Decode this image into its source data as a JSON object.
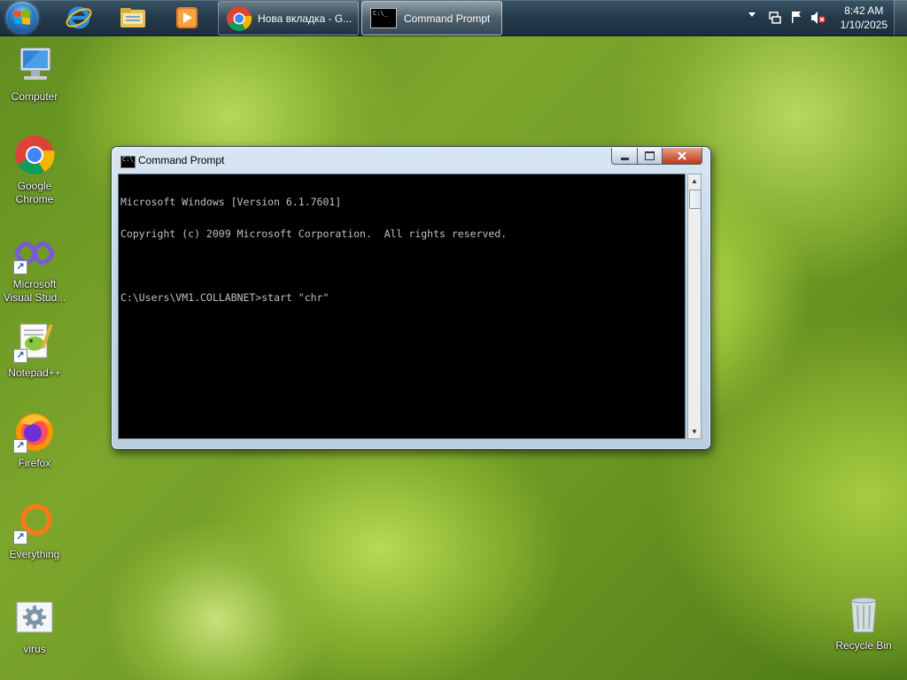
{
  "taskbar": {
    "tasks": [
      {
        "label": "Нова вкладка - G...",
        "icon": "chrome-icon",
        "active": false
      },
      {
        "label": "Command Prompt",
        "icon": "cmd-icon",
        "active": true
      }
    ],
    "pinned": [
      "internet-explorer-icon",
      "windows-explorer-icon",
      "media-player-icon"
    ],
    "clock": {
      "time": "8:42 AM",
      "date": "1/10/2025"
    }
  },
  "desktop": {
    "icons": [
      {
        "label": "Computer",
        "icon": "computer-icon"
      },
      {
        "label": "Google\nChrome",
        "icon": "chrome-icon"
      },
      {
        "label": "Microsoft\nVisual Stud...",
        "icon": "visual-studio-icon"
      },
      {
        "label": "Notepad++",
        "icon": "notepad-plus-plus-icon"
      },
      {
        "label": "Firefox",
        "icon": "firefox-icon"
      },
      {
        "label": "Everything",
        "icon": "everything-search-icon"
      },
      {
        "label": "virus",
        "icon": "settings-file-icon"
      },
      {
        "label": "Recycle Bin",
        "icon": "recycle-bin-icon"
      }
    ]
  },
  "cmd_window": {
    "title": "Command Prompt",
    "icon_text": "C:\\_",
    "lines": [
      "Microsoft Windows [Version 6.1.7601]",
      "Copyright (c) 2009 Microsoft Corporation.  All rights reserved.",
      "",
      "C:\\Users\\VM1.COLLABNET>start \"chr\""
    ]
  }
}
